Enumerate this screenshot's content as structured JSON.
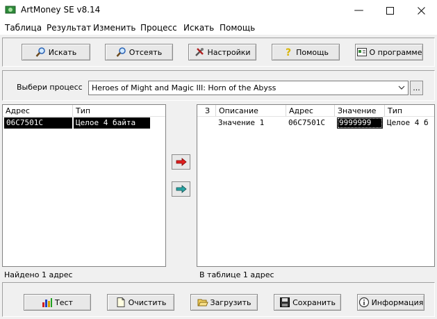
{
  "window": {
    "title": "ArtMoney SE v8.14"
  },
  "menu": [
    "Таблица",
    "Результат",
    "Изменить",
    "Процесс",
    "Искать",
    "Помощь"
  ],
  "toolbar": {
    "search": "Искать",
    "filter": "Отсеять",
    "settings": "Настройки",
    "help": "Помощь",
    "about": "О программе"
  },
  "process": {
    "label": "Выбери процесс",
    "selected": "Heroes of Might and Magic III: Horn of the Abyss",
    "browse": "..."
  },
  "results": {
    "headers": {
      "address": "Адрес",
      "type": "Тип"
    },
    "rows": [
      {
        "address": "06C7501C",
        "type": "Целое 4 байта"
      }
    ],
    "status": "Найдено 1 адрес"
  },
  "table": {
    "headers": {
      "freeze": "З",
      "description": "Описание",
      "address": "Адрес",
      "value": "Значение",
      "type": "Тип"
    },
    "rows": [
      {
        "description": "Значение 1",
        "address": "06C7501C",
        "value": "9999999",
        "type": "Целое 4 б"
      }
    ],
    "status": "В таблице 1 адрес"
  },
  "bottom": {
    "test": "Тест",
    "clear": "Очистить",
    "load": "Загрузить",
    "save": "Сохранить",
    "info": "Информация"
  },
  "colors": {
    "selection": "#000000",
    "highlight_row": "#0078d7"
  },
  "icons": {
    "app": "app-icon",
    "minimize": "minimize-icon",
    "maximize": "maximize-icon",
    "close": "close-icon",
    "search": "magnifier-icon",
    "filter": "magnifier-filter-icon",
    "settings": "tools-icon",
    "help": "question-icon",
    "about": "info-card-icon",
    "move_right": "red-arrow-right-icon",
    "move_right_all": "teal-arrow-right-icon",
    "test": "bar-chart-icon",
    "clear": "new-document-icon",
    "load": "open-folder-icon",
    "save": "floppy-disk-icon",
    "info": "info-icon"
  }
}
